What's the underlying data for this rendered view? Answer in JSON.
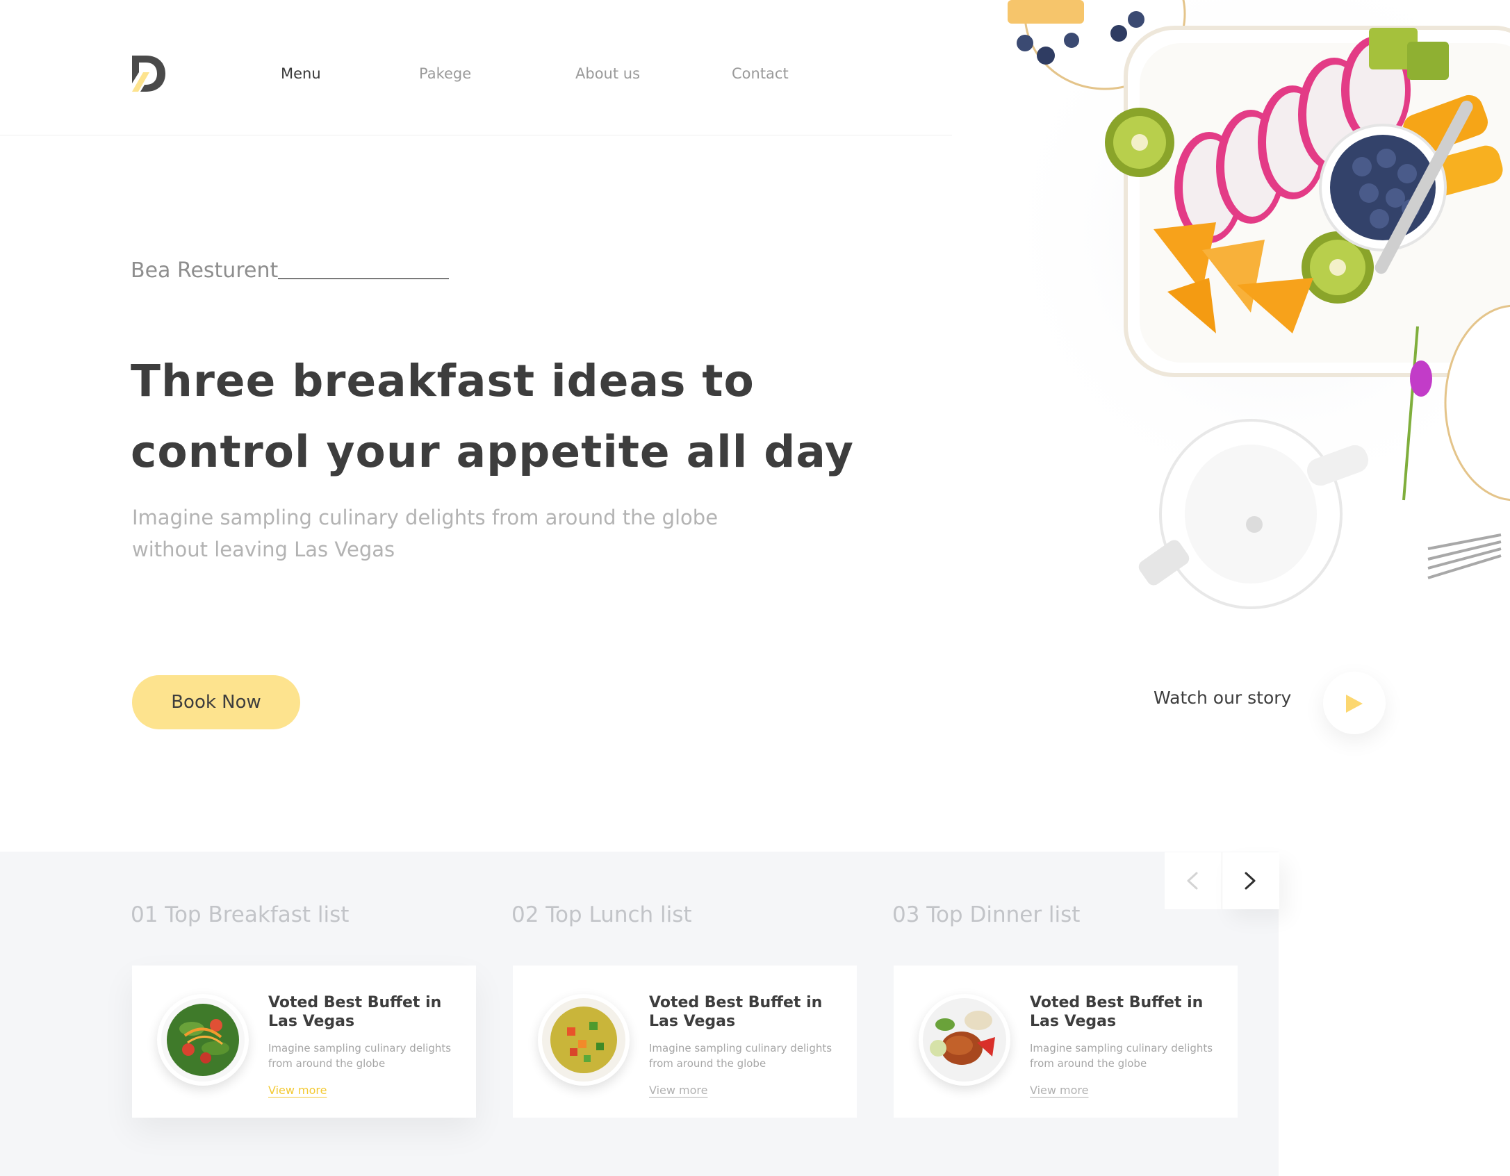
{
  "brand": {
    "logo_icon": "dp-monogram-logo-icon",
    "accent_color": "#fde38e",
    "link_accent_color": "#f3c933"
  },
  "nav": {
    "items": [
      {
        "label": "Menu",
        "active": true
      },
      {
        "label": "Pakege",
        "active": false
      },
      {
        "label": "About us",
        "active": false
      },
      {
        "label": "Contact",
        "active": false
      }
    ]
  },
  "hero": {
    "eyebrow": "Bea Resturent",
    "headline_line1": "Three breakfast ideas to",
    "headline_line2": "control your appetite all day",
    "subtitle_line1": "Imagine sampling culinary delights from around the globe",
    "subtitle_line2": "without leaving Las Vegas",
    "cta_label": "Book Now",
    "watch_label": "Watch our story",
    "image_icon": "breakfast-platter-photo"
  },
  "lists": {
    "prev_icon": "chevron-left-icon",
    "next_icon": "chevron-right-icon",
    "titles": [
      "01 Top Breakfast list",
      "02 Top Lunch list",
      "03 Top Dinner list"
    ],
    "cards": [
      {
        "title": "Voted Best Buffet in Las Vegas",
        "description": "Imagine sampling culinary delights from around the globe",
        "link": "View more",
        "link_highlighted": true,
        "image_icon": "salad-bowl-icon"
      },
      {
        "title": "Voted Best Buffet in Las Vegas",
        "description": "Imagine sampling culinary delights from around the globe",
        "link": "View more",
        "link_highlighted": false,
        "image_icon": "vegetable-soup-icon"
      },
      {
        "title": "Voted Best Buffet in Las Vegas",
        "description": "Imagine sampling culinary delights from around the globe",
        "link": "View more",
        "link_highlighted": false,
        "image_icon": "roast-chicken-plate-icon"
      }
    ]
  }
}
